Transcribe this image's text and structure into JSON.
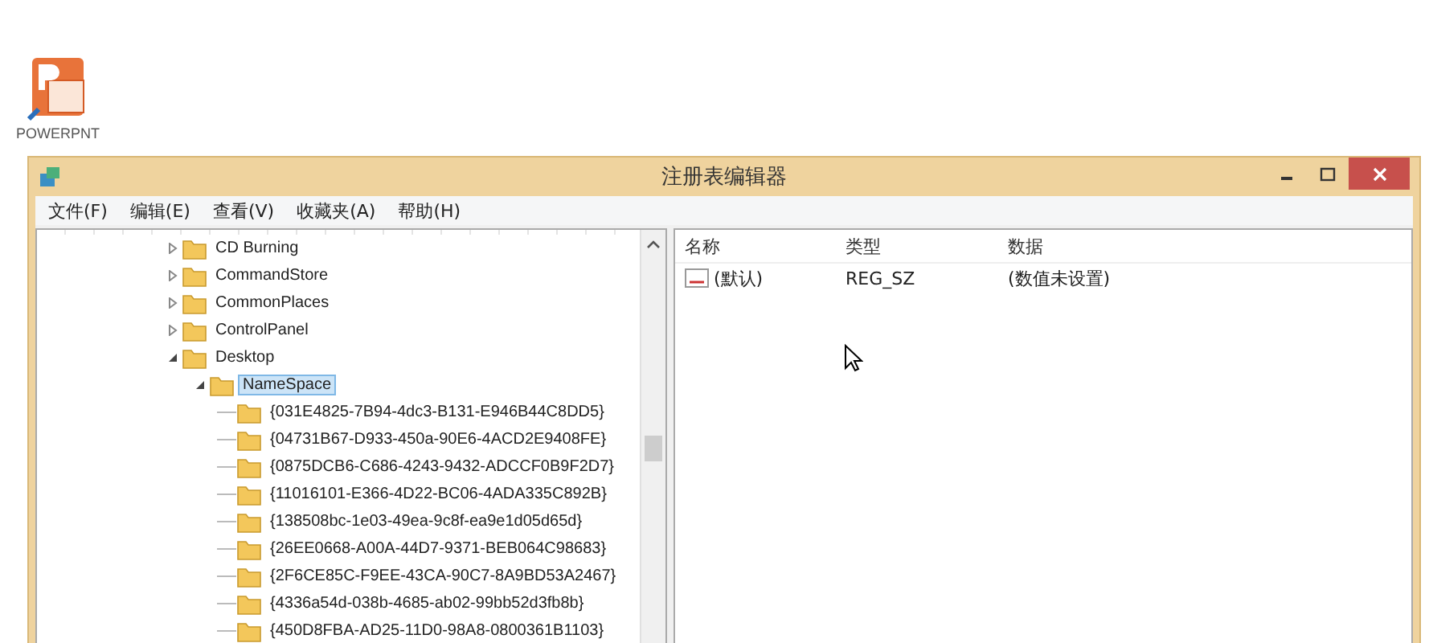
{
  "desktop_icon": {
    "label": "POWERPNT"
  },
  "window": {
    "title": "注册表编辑器"
  },
  "menu": [
    "文件(F)",
    "编辑(E)",
    "查看(V)",
    "收藏夹(A)",
    "帮助(H)"
  ],
  "tree": [
    {
      "label": "CD Burning",
      "expanded": false,
      "selected": false
    },
    {
      "label": "CommandStore",
      "expanded": false,
      "selected": false
    },
    {
      "label": "CommonPlaces",
      "expanded": false,
      "selected": false
    },
    {
      "label": "ControlPanel",
      "expanded": false,
      "selected": false
    },
    {
      "label": "Desktop",
      "expanded": true,
      "selected": false,
      "children": [
        {
          "label": "NameSpace",
          "expanded": true,
          "selected": true,
          "children": [
            {
              "label": "{031E4825-7B94-4dc3-B131-E946B44C8DD5}",
              "selected": false
            },
            {
              "label": "{04731B67-D933-450a-90E6-4ACD2E9408FE}",
              "selected": false
            },
            {
              "label": "{0875DCB6-C686-4243-9432-ADCCF0B9F2D7}",
              "selected": false
            },
            {
              "label": "{11016101-E366-4D22-BC06-4ADA335C892B}",
              "selected": false
            },
            {
              "label": "{138508bc-1e03-49ea-9c8f-ea9e1d05d65d}",
              "selected": false
            },
            {
              "label": "{26EE0668-A00A-44D7-9371-BEB064C98683}",
              "selected": false
            },
            {
              "label": "{2F6CE85C-F9EE-43CA-90C7-8A9BD53A2467}",
              "selected": false
            },
            {
              "label": "{4336a54d-038b-4685-ab02-99bb52d3fb8b}",
              "selected": false
            },
            {
              "label": "{450D8FBA-AD25-11D0-98A8-0800361B1103}",
              "selected": false
            }
          ]
        }
      ]
    }
  ],
  "list": {
    "columns": [
      "名称",
      "类型",
      "数据"
    ],
    "rows": [
      {
        "name": "(默认)",
        "type": "REG_SZ",
        "data": "(数值未设置)"
      }
    ]
  }
}
